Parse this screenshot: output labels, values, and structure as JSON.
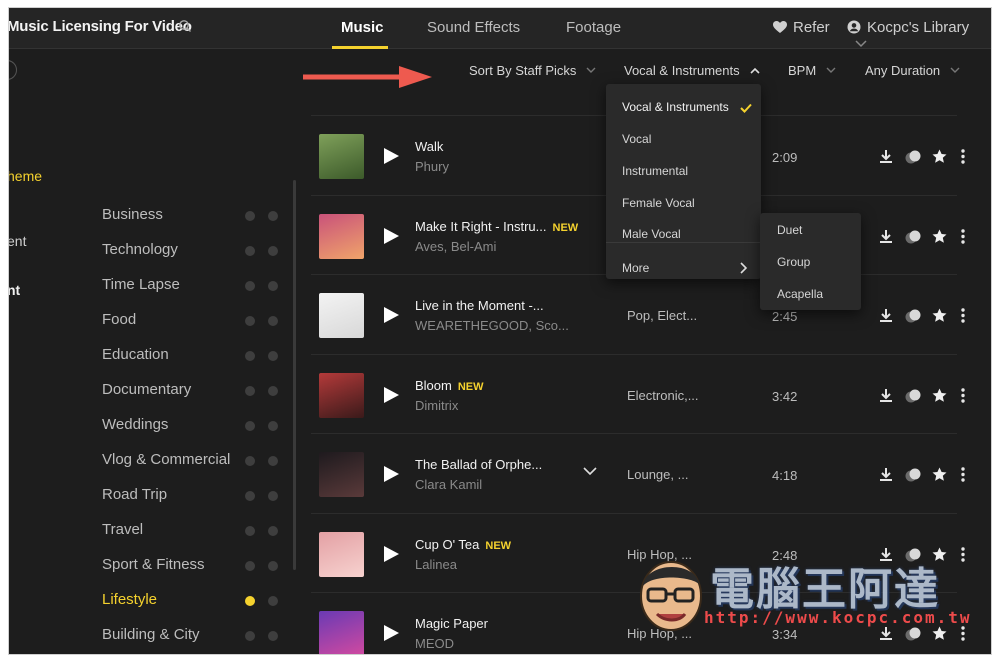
{
  "header": {
    "brand": "Music Licensing For Video",
    "tabs": [
      {
        "label": "Music",
        "active": true
      },
      {
        "label": "Sound Effects",
        "active": false
      },
      {
        "label": "Footage",
        "active": false
      }
    ],
    "refer": "Refer",
    "library": "Kocpc's Library"
  },
  "filters": {
    "sort": "Sort By Staff Picks",
    "vocal": "Vocal & Instruments",
    "bpm": "BPM",
    "duration": "Any Duration"
  },
  "vocal_dropdown": {
    "items": [
      {
        "label": "Vocal & Instruments",
        "selected": true
      },
      {
        "label": "Vocal",
        "selected": false
      },
      {
        "label": "Instrumental",
        "selected": false
      },
      {
        "label": "Female Vocal",
        "selected": false
      },
      {
        "label": "Male Vocal",
        "selected": false
      }
    ],
    "more": "More",
    "submenu": [
      "Duet",
      "Group",
      "Acapella"
    ]
  },
  "left_fragments": [
    "heme",
    "ent",
    "nt"
  ],
  "categories": [
    {
      "label": "Business",
      "active": false
    },
    {
      "label": "Technology",
      "active": false
    },
    {
      "label": "Time Lapse",
      "active": false
    },
    {
      "label": "Food",
      "active": false
    },
    {
      "label": "Education",
      "active": false
    },
    {
      "label": "Documentary",
      "active": false
    },
    {
      "label": "Weddings",
      "active": false
    },
    {
      "label": "Vlog & Commercial",
      "active": false
    },
    {
      "label": "Road Trip",
      "active": false
    },
    {
      "label": "Travel",
      "active": false
    },
    {
      "label": "Sport & Fitness",
      "active": false
    },
    {
      "label": "Lifestyle",
      "active": true
    },
    {
      "label": "Building & City",
      "active": false
    }
  ],
  "tracks": [
    {
      "title": "Walk",
      "new": "",
      "artist": "Phury",
      "genre": "",
      "duration": "2:09",
      "colors": [
        "#7fa05a",
        "#3c5a2a"
      ]
    },
    {
      "title": "Make It Right - Instru...",
      "new": "NEW",
      "artist": "Aves, Bel-Ami",
      "genre": "",
      "duration": "",
      "colors": [
        "#c9527a",
        "#f0a46a"
      ]
    },
    {
      "title": "Live in the Moment -...",
      "new": "",
      "artist": "WEARETHEGOOD, Sco...",
      "genre": "Pop,  Elect...",
      "duration": "2:45",
      "colors": [
        "#f3f3f3",
        "#d8d8d8"
      ]
    },
    {
      "title": "Bloom",
      "new": "NEW",
      "artist": "Dimitrix",
      "genre": "Electronic,...",
      "duration": "3:42",
      "colors": [
        "#b43a3a",
        "#3a1a1a"
      ]
    },
    {
      "title": "The Ballad of Orphe...",
      "new": "",
      "artist": "Clara Kamil",
      "genre": "Lounge,  ...",
      "duration": "4:18",
      "colors": [
        "#1e1a1e",
        "#5a3a3a"
      ]
    },
    {
      "title": "Cup O' Tea",
      "new": "NEW",
      "artist": "Lalinea",
      "genre": "Hip Hop,  ...",
      "duration": "2:48",
      "colors": [
        "#e3a0a4",
        "#f7d2cf"
      ]
    },
    {
      "title": "Magic Paper",
      "new": "",
      "artist": "MEOD",
      "genre": "Hip Hop,  ...",
      "duration": "3:34",
      "colors": [
        "#6a3ab4",
        "#d24aa0"
      ]
    }
  ],
  "watermark": {
    "title": "電腦王阿達",
    "url": "http://www.kocpc.com.tw"
  },
  "accent_color": "#f5d22e"
}
